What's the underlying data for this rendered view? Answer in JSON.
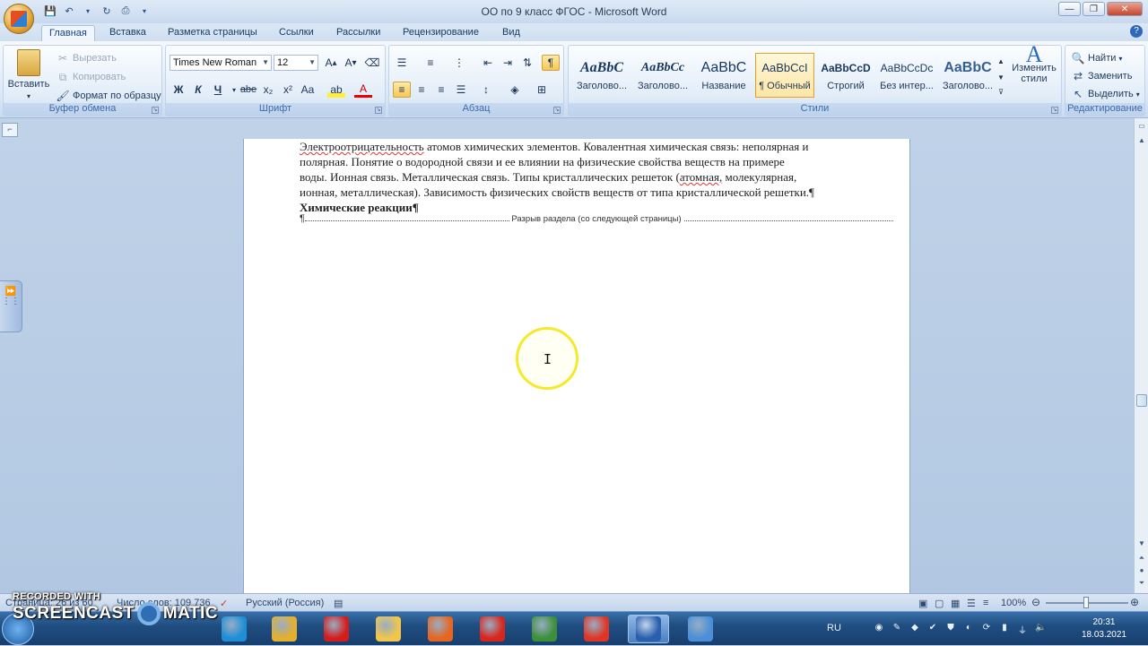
{
  "window": {
    "title": "ОО по 9 класс  ФГОС - Microsoft Word"
  },
  "quick_access": [
    "save-icon",
    "undo-icon",
    "redo-icon",
    "print-preview-icon"
  ],
  "tabs": [
    "Главная",
    "Вставка",
    "Разметка страницы",
    "Ссылки",
    "Рассылки",
    "Рецензирование",
    "Вид"
  ],
  "active_tab": "Главная",
  "clipboard": {
    "paste": "Вставить",
    "cut": "Вырезать",
    "copy": "Копировать",
    "format_painter": "Формат по образцу",
    "label": "Буфер обмена"
  },
  "font": {
    "name": "Times New Roman",
    "size": "12",
    "label": "Шрифт",
    "buttons": [
      "Ж",
      "К",
      "Ч",
      "abe",
      "x₂",
      "x²",
      "Aa"
    ]
  },
  "paragraph": {
    "label": "Абзац"
  },
  "styles": {
    "label": "Стили",
    "items": [
      {
        "sample": "AaBbC",
        "name": "Заголово..."
      },
      {
        "sample": "AaBbCc",
        "name": "Заголово..."
      },
      {
        "sample": "AaBbC",
        "name": "Название"
      },
      {
        "sample": "AaBbCcI",
        "name": "¶ Обычный"
      },
      {
        "sample": "AaBbCcD",
        "name": "Строгий"
      },
      {
        "sample": "AaBbCcDc",
        "name": "Без интер..."
      },
      {
        "sample": "AaBbC",
        "name": "Заголово..."
      }
    ],
    "selected_index": 3,
    "change_styles": "Изменить стили"
  },
  "editing": {
    "find": "Найти",
    "replace": "Заменить",
    "select": "Выделить",
    "label": "Редактирование"
  },
  "document": {
    "lines": [
      "Электроотрицательность атомов химических элементов. Ковалентная химическая связь: неполярная и",
      "полярная. Понятие о водородной связи и ее влиянии на физические свойства веществ на примере",
      "воды. Ионная связь. Металлическая связь. Типы кристаллических решеток (атомная, молекулярная,",
      "ионная, металлическая). Зависимость физических свойств веществ от типа кристаллической решетки.¶"
    ],
    "heading": "Химические реакции¶",
    "section_break": "Разрыв раздела (со следующей страницы)"
  },
  "status": {
    "page": "Страница: 26 из 60",
    "words": "Число слов: 109 736",
    "language": "Русский (Россия)",
    "zoom": "100%"
  },
  "watermark": {
    "line1": "RECORDED WITH",
    "line2a": "SCREENCAST",
    "line2b": "MATIC"
  },
  "taskbar": {
    "apps": [
      {
        "name": "taskbar-edge-icon",
        "color": "#1e8fd6"
      },
      {
        "name": "taskbar-chrome-icon",
        "color": "#e5b02c"
      },
      {
        "name": "taskbar-opera-icon",
        "color": "#d51c1c"
      },
      {
        "name": "taskbar-explorer-icon",
        "color": "#f1c64a"
      },
      {
        "name": "taskbar-firefox-icon",
        "color": "#e8651f"
      },
      {
        "name": "taskbar-yandex-icon",
        "color": "#d9261c"
      },
      {
        "name": "taskbar-chart-app-icon",
        "color": "#3e8f3a"
      },
      {
        "name": "taskbar-yandex-browser-icon",
        "color": "#e03524"
      },
      {
        "name": "taskbar-word-icon",
        "color": "#2a5fae"
      },
      {
        "name": "taskbar-recorder-icon",
        "color": "#4a8fd8"
      }
    ],
    "lang": "RU",
    "time": "20:31",
    "date": "18.03.2021"
  }
}
